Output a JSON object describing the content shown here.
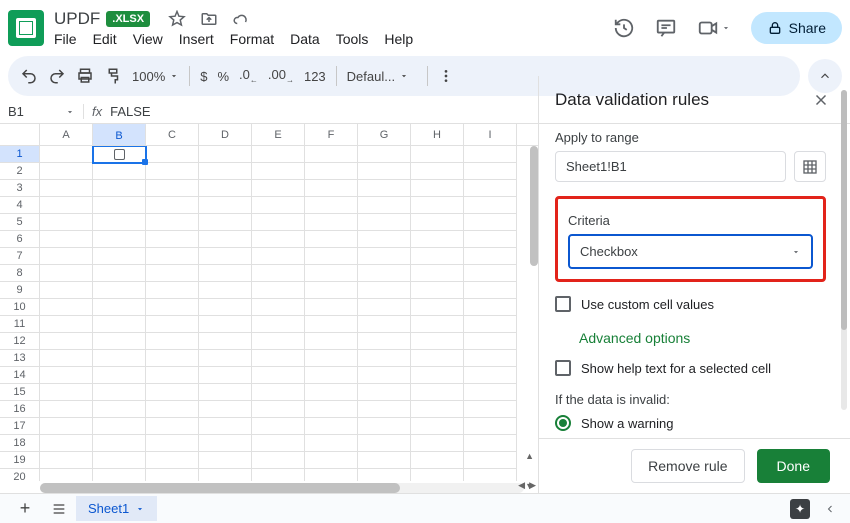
{
  "doc": {
    "title": "UPDF",
    "ext": ".XLSX"
  },
  "menu": {
    "file": "File",
    "edit": "Edit",
    "view": "View",
    "insert": "Insert",
    "format": "Format",
    "data": "Data",
    "tools": "Tools",
    "help": "Help"
  },
  "share": "Share",
  "toolbar": {
    "zoom": "100%",
    "currency": "$",
    "percent": "%",
    "num123": "123",
    "font": "Defaul..."
  },
  "namebox": "B1",
  "formula": "FALSE",
  "columns": [
    "A",
    "B",
    "C",
    "D",
    "E",
    "F",
    "G",
    "H",
    "I"
  ],
  "rows": [
    1,
    2,
    3,
    4,
    5,
    6,
    7,
    8,
    9,
    10,
    11,
    12,
    13,
    14,
    15,
    16,
    17,
    18,
    19,
    20
  ],
  "active_col": "B",
  "active_row": 1,
  "sidepanel": {
    "title": "Data validation rules",
    "apply_label": "Apply to range",
    "range_value": "Sheet1!B1",
    "criteria_label": "Criteria",
    "criteria_value": "Checkbox",
    "custom_values": "Use custom cell values",
    "advanced": "Advanced options",
    "help_text": "Show help text for a selected cell",
    "invalid_label": "If the data is invalid:",
    "show_warning": "Show a warning",
    "remove": "Remove rule",
    "done": "Done"
  },
  "tabs": {
    "sheet1": "Sheet1"
  }
}
